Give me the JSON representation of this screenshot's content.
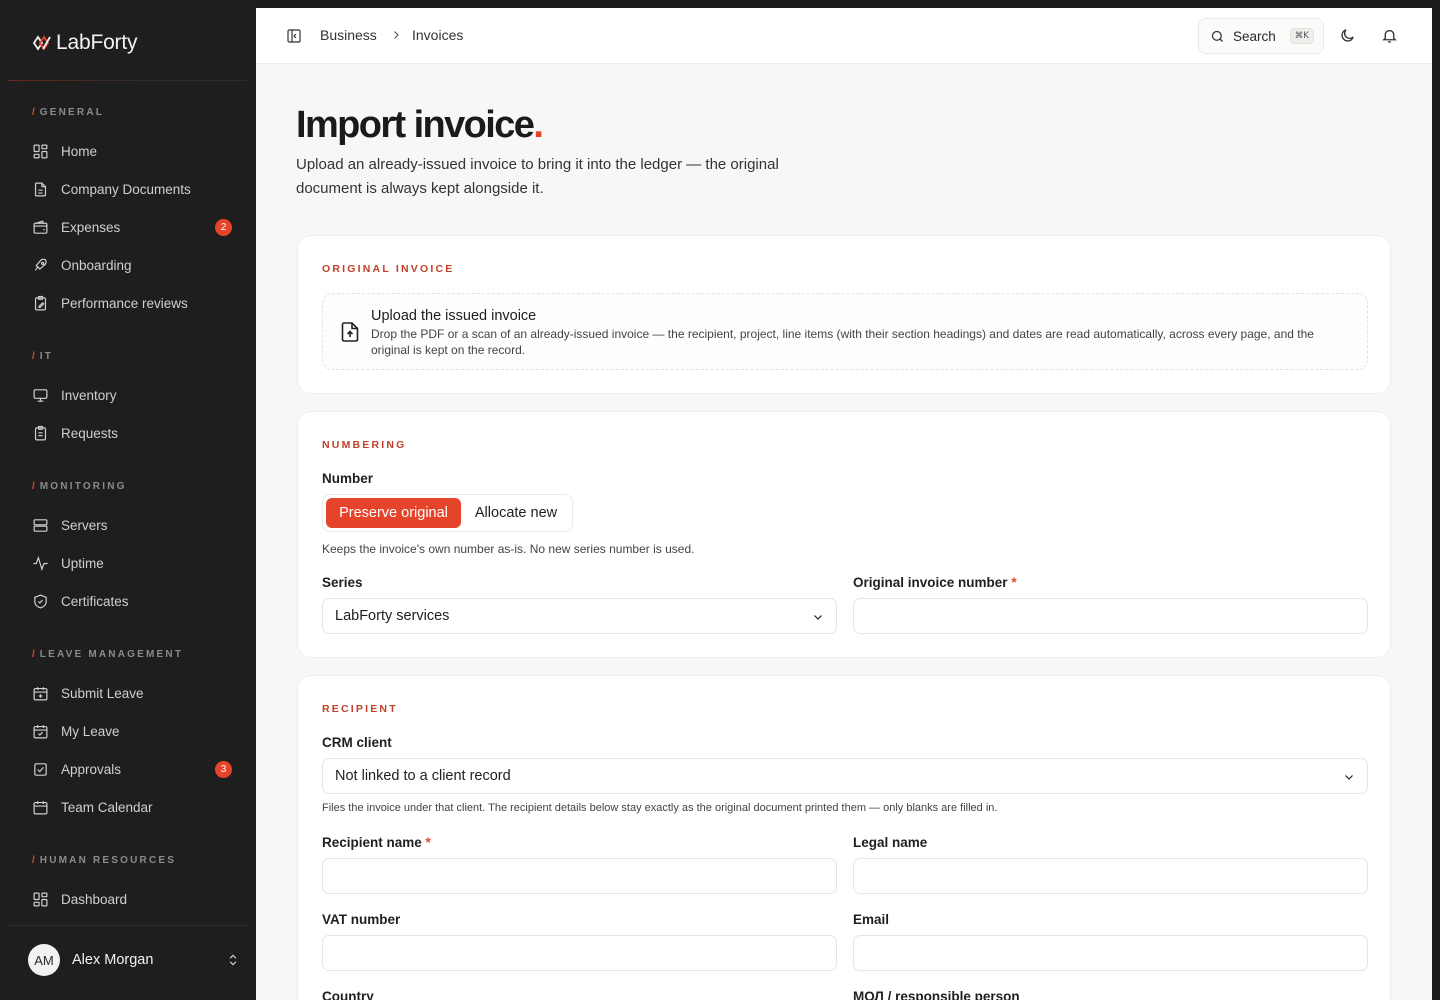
{
  "brand": {
    "name": "LabForty"
  },
  "sidebar": {
    "sections": [
      {
        "title": "GENERAL",
        "items": [
          {
            "label": "Home",
            "icon": "grid-icon"
          },
          {
            "label": "Company Documents",
            "icon": "document-icon"
          },
          {
            "label": "Expenses",
            "icon": "wallet-icon",
            "badge": "2"
          },
          {
            "label": "Onboarding",
            "icon": "rocket-icon"
          },
          {
            "label": "Performance reviews",
            "icon": "clipboard-pen-icon"
          }
        ]
      },
      {
        "title": "IT",
        "items": [
          {
            "label": "Inventory",
            "icon": "monitor-icon"
          },
          {
            "label": "Requests",
            "icon": "clipboard-list-icon"
          }
        ]
      },
      {
        "title": "MONITORING",
        "items": [
          {
            "label": "Servers",
            "icon": "server-icon"
          },
          {
            "label": "Uptime",
            "icon": "pulse-icon"
          },
          {
            "label": "Certificates",
            "icon": "shield-check-icon"
          }
        ]
      },
      {
        "title": "LEAVE MANAGEMENT",
        "items": [
          {
            "label": "Submit Leave",
            "icon": "calendar-plus-icon"
          },
          {
            "label": "My Leave",
            "icon": "calendar-check-icon"
          },
          {
            "label": "Approvals",
            "icon": "checkbox-icon",
            "badge": "3"
          },
          {
            "label": "Team Calendar",
            "icon": "calendar-icon"
          }
        ]
      },
      {
        "title": "HUMAN RESOURCES",
        "items": [
          {
            "label": "Dashboard",
            "icon": "grid-icon"
          }
        ]
      }
    ],
    "slash": "/"
  },
  "user": {
    "initials": "AM",
    "name": "Alex Morgan"
  },
  "topbar": {
    "breadcrumb": [
      "Business",
      "Invoices"
    ],
    "search_label": "Search",
    "search_shortcut": "⌘K"
  },
  "page": {
    "title": "Import invoice",
    "title_dot": ".",
    "subtitle": "Upload an already-issued invoice to bring it into the ledger — the original document is always kept alongside it."
  },
  "original_invoice": {
    "section_title": "ORIGINAL INVOICE",
    "upload_title": "Upload the issued invoice",
    "upload_desc": "Drop the PDF or a scan of an already-issued invoice — the recipient, project, line items (with their section headings) and dates are read automatically, across every page, and the original is kept on the record."
  },
  "numbering": {
    "section_title": "NUMBERING",
    "number_label": "Number",
    "option_preserve": "Preserve original",
    "option_allocate": "Allocate new",
    "selected": "Preserve original",
    "hint": "Keeps the invoice's own number as-is. No new series number is used.",
    "series_label": "Series",
    "series_value": "LabForty services",
    "original_number_label": "Original invoice number",
    "required_mark": "*",
    "original_number_value": ""
  },
  "recipient": {
    "section_title": "RECIPIENT",
    "crm_label": "CRM client",
    "crm_value": "Not linked to a client record",
    "crm_hint": "Files the invoice under that client. The recipient details below stay exactly as the original document printed them — only blanks are filled in.",
    "recipient_name_label": "Recipient name",
    "legal_name_label": "Legal name",
    "vat_label": "VAT number",
    "email_label": "Email",
    "country_label": "Country",
    "responsible_label": "МОЛ / responsible person",
    "required_mark": "*"
  },
  "colors": {
    "accent": "#e5442a",
    "sidebar_bg": "#1e1e1e",
    "page_bg": "#f8f7f6"
  }
}
